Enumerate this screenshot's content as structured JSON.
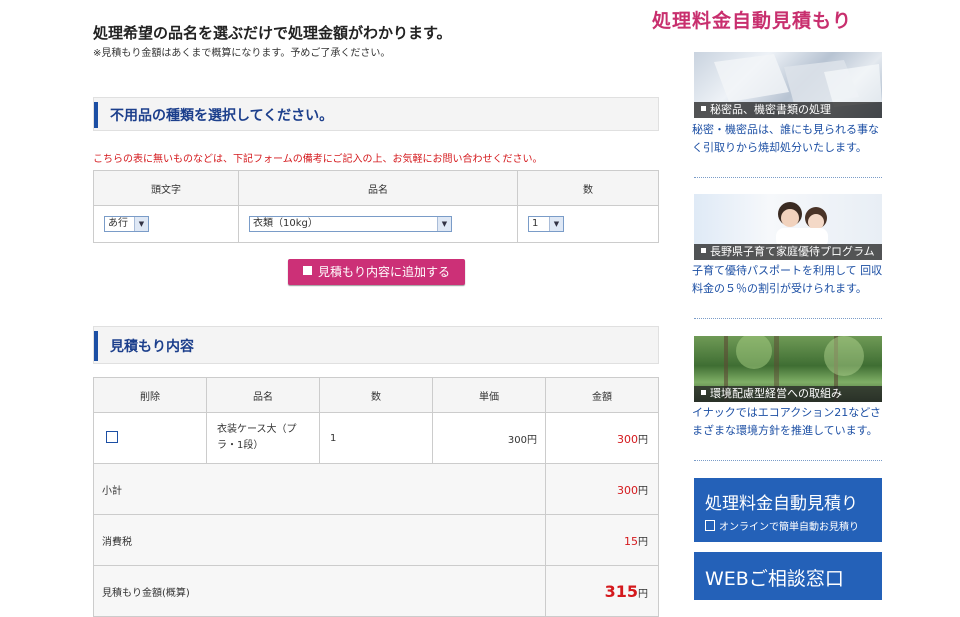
{
  "header": {
    "intro_title": "処理希望の品名を選ぶだけで処理金額がわかります。",
    "intro_note": "※見積もり金額はあくまで概算になります。予めご了承ください。",
    "site_title": "処理料金自動見積もり"
  },
  "select_section": {
    "heading": "不用品の種類を選択してください。",
    "note": "こちらの表に無いものなどは、下記フォームの備考にご記入の上、お気軽にお問い合わせください。",
    "columns": [
      "頭文字",
      "品名",
      "数"
    ],
    "initial_value": "あ行",
    "item_value": "衣類（10kg）",
    "qty_value": "1",
    "add_button": "見積もり内容に追加する"
  },
  "estimate_section": {
    "heading": "見積もり内容",
    "columns": [
      "削除",
      "品名",
      "数",
      "単価",
      "金額"
    ],
    "row": {
      "name": "衣装ケース大（プラ・1段）",
      "qty": "1",
      "unit_price": "300円",
      "amount": "300",
      "yen": "円"
    },
    "subtotal_label": "小計",
    "subtotal": "300",
    "tax_label": "消費税",
    "tax": "15",
    "total_label": "見積もり金額(概算)",
    "total": "315",
    "yen": "円"
  },
  "sidebar": {
    "cards": [
      {
        "caption": "秘密品、機密書類の処理",
        "text": "秘密・機密品は、誰にも見られる事なく引取りから焼却処分いたします。"
      },
      {
        "caption": "長野県子育て家庭優待プログラム",
        "text": "子育て優待パスポートを利用して 回収料金の５％の割引が受けられます。"
      },
      {
        "caption": "環境配慮型経営への取組み",
        "text": "イナックではエコアクション21などさまざまな環境方針を推進しています。"
      }
    ],
    "box1": {
      "title": "処理料金自動見積り",
      "sub": "オンラインで簡単自動お見積り"
    },
    "box2": {
      "title": "WEBご相談窓口"
    }
  },
  "colors": {
    "accent_pink": "#c82f6e",
    "accent_blue": "#2461b8",
    "alert_red": "#d4191d"
  }
}
